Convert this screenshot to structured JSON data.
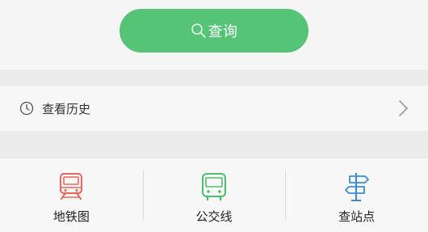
{
  "query_button": {
    "label": "查询",
    "icon": "search-icon"
  },
  "history": {
    "label": "查看历史",
    "icon": "clock-icon",
    "chevron_icon": "chevron-right-icon"
  },
  "nav": [
    {
      "label": "地铁图",
      "icon": "subway-icon",
      "color": "#e9665f"
    },
    {
      "label": "公交线",
      "icon": "bus-icon",
      "color": "#4dbd6b"
    },
    {
      "label": "查站点",
      "icon": "signpost-icon",
      "color": "#3f8dd0"
    }
  ],
  "colors": {
    "accent_green": "#56c476",
    "background": "#f5f5f5",
    "separator": "#ececec"
  }
}
